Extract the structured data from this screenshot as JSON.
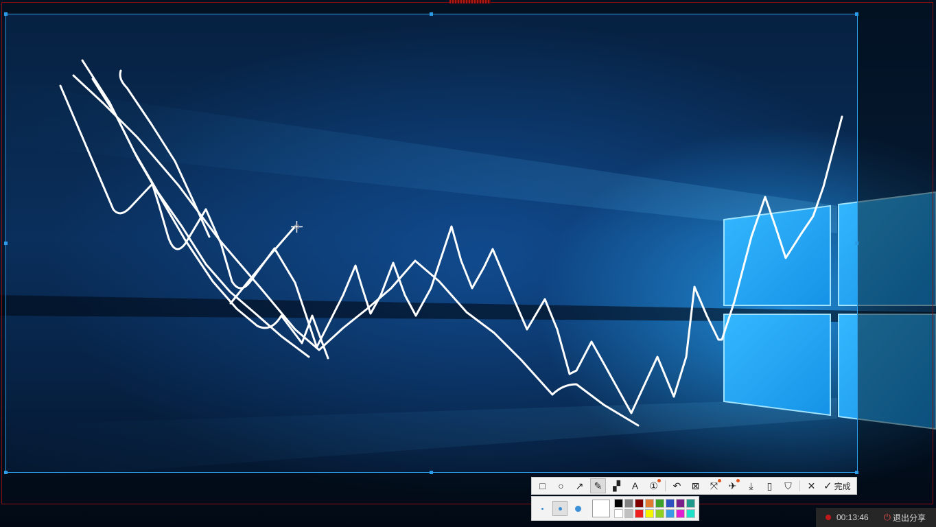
{
  "toolbar": {
    "tools": [
      {
        "name": "rectangle-tool",
        "icon": "rectangle-icon",
        "glyph": "□"
      },
      {
        "name": "ellipse-tool",
        "icon": "circle-icon",
        "glyph": "○"
      },
      {
        "name": "arrow-tool",
        "icon": "arrow-icon",
        "glyph": "↗"
      },
      {
        "name": "pen-tool",
        "icon": "pencil-icon",
        "glyph": "✎",
        "active": true
      },
      {
        "name": "mosaic-tool",
        "icon": "mosaic-icon",
        "glyph": "▞"
      },
      {
        "name": "text-tool",
        "icon": "text-icon",
        "glyph": "A"
      },
      {
        "name": "number-tool",
        "icon": "number-badge-icon",
        "glyph": "①",
        "badge": true
      }
    ],
    "actions": [
      {
        "name": "undo-button",
        "icon": "undo-icon",
        "glyph": "↶"
      },
      {
        "name": "ocr-button",
        "icon": "scan-icon",
        "glyph": "⊠"
      },
      {
        "name": "expand-button",
        "icon": "expand-icon",
        "glyph": "⤧",
        "badge": true
      },
      {
        "name": "pin-button",
        "icon": "pin-icon",
        "glyph": "✈",
        "badge": true
      },
      {
        "name": "download-button",
        "icon": "download-icon",
        "glyph": "⤓"
      },
      {
        "name": "phone-button",
        "icon": "phone-icon",
        "glyph": "▯"
      },
      {
        "name": "bookmark-button",
        "icon": "bookmark-icon",
        "glyph": "⛉"
      }
    ],
    "cancel_glyph": "✕",
    "done_glyph": "✓",
    "done_label": "完成"
  },
  "subbar": {
    "sizes": [
      "small",
      "medium",
      "large"
    ],
    "active_size": 1,
    "current_color": "#ffffff",
    "palette": [
      "#000000",
      "#808080",
      "#800000",
      "#e07a30",
      "#3aa02a",
      "#2d4fbf",
      "#7a1f8a",
      "#1f9a8a",
      "#ffffff",
      "#c0c0c0",
      "#ee2020",
      "#f5f500",
      "#90d020",
      "#3a9ae8",
      "#e020d0",
      "#20e0c8"
    ]
  },
  "status": {
    "timer": "00:13:46",
    "exit_label": "退出分享"
  }
}
